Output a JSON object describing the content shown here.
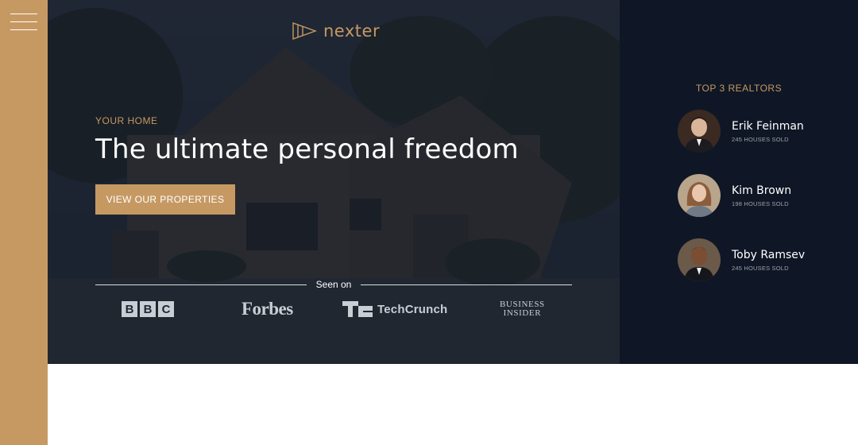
{
  "brand": {
    "logo_text": "nexter",
    "accent_color": "#c69963",
    "dark_color": "#0f1726"
  },
  "sidebar": {
    "menu_icon": "hamburger-menu-icon"
  },
  "hero": {
    "eyebrow": "YOUR HOME",
    "headline": "The ultimate personal freedom",
    "cta_label": "VIEW OUR PROPERTIES",
    "seen_on_label": "Seen on",
    "brands": {
      "bbc": [
        "B",
        "B",
        "C"
      ],
      "forbes": "Forbes",
      "techcrunch": "TechCrunch",
      "business_insider": [
        "BUSINESS",
        "INSIDER"
      ]
    }
  },
  "realtors": {
    "title": "TOP 3 REALTORS",
    "items": [
      {
        "name": "Erik Feinman",
        "sold": "245 HOUSES SOLD"
      },
      {
        "name": "Kim Brown",
        "sold": "198 HOUSES SOLD"
      },
      {
        "name": "Toby Ramsev",
        "sold": "245 HOUSES SOLD"
      }
    ]
  }
}
